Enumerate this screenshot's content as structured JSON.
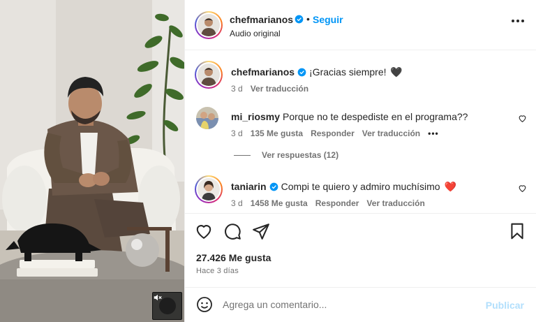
{
  "post": {
    "author": "chefmarianos",
    "follow_label": "Seguir",
    "dot": "•",
    "audio_label": "Audio original"
  },
  "comments": [
    {
      "username": "chefmarianos",
      "text": "¡Gracias siempre!",
      "emoji": "🖤",
      "time": "3 d",
      "translate": "Ver traducción"
    },
    {
      "username": "mi_riosmy",
      "text": "Porque no te despediste en el programa??",
      "time": "3 d",
      "likes": "135 Me gusta",
      "reply": "Responder",
      "translate": "Ver traducción",
      "more": "•••"
    },
    {
      "username": "taniarin",
      "text": "Compi te quiero y admiro muchísimo",
      "emoji": "❤️",
      "time": "3 d",
      "likes": "1458 Me gusta",
      "reply": "Responder",
      "translate": "Ver traducción"
    }
  ],
  "view_replies_label": "Ver respuestas (12)",
  "likes_total": "27.426 Me gusta",
  "posted_ago": "Hace 3 días",
  "composer": {
    "placeholder": "Agrega un comentario...",
    "publish_label": "Publicar"
  },
  "colors": {
    "accent": "#0095f6",
    "publish_disabled": "#b2dffc",
    "verified": "#0095f6",
    "heart_red": "#ed4956",
    "muted_text": "#737373"
  },
  "icons": [
    "more-options-icon",
    "verified-badge-icon",
    "heart-icon",
    "comment-icon",
    "share-icon",
    "bookmark-icon",
    "emoji-icon",
    "sound-off-icon"
  ]
}
